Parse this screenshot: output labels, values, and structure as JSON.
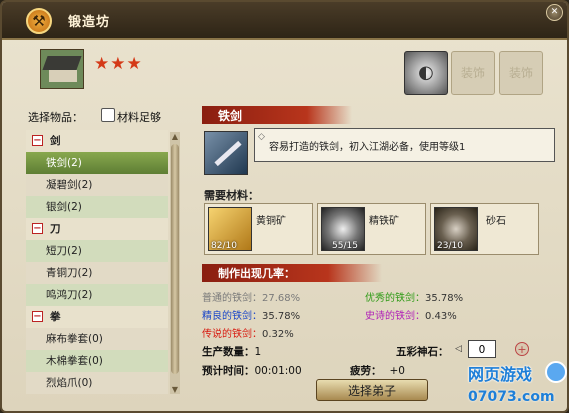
{
  "title": "锻造坊",
  "stars": "★★★",
  "equip_slots": [
    "装饰",
    "装饰"
  ],
  "select_label": "选择物品：",
  "material_enough_label": "材料足够",
  "item_list": [
    {
      "type": "category",
      "label": "剑"
    },
    {
      "type": "item",
      "label": "铁剑(2)",
      "selected": true
    },
    {
      "type": "item",
      "label": "凝碧剑(2)"
    },
    {
      "type": "item",
      "label": "银剑(2)"
    },
    {
      "type": "category",
      "label": "刀"
    },
    {
      "type": "item",
      "label": "短刀(2)"
    },
    {
      "type": "item",
      "label": "青铜刀(2)"
    },
    {
      "type": "item",
      "label": "鸣鸿刀(2)"
    },
    {
      "type": "category",
      "label": "拳"
    },
    {
      "type": "item",
      "label": "麻布拳套(0)"
    },
    {
      "type": "item",
      "label": "木棉拳套(0)"
    },
    {
      "type": "item",
      "label": "烈焰爪(0)"
    }
  ],
  "item": {
    "name": "铁剑",
    "description": "容易打造的铁剑，初入江湖必备，使用等级1"
  },
  "materials_heading": "需要材料：",
  "materials": [
    {
      "name": "黄铜矿",
      "count": "82/10"
    },
    {
      "name": "精铁矿",
      "count": "55/15"
    },
    {
      "name": "砂石",
      "count": "23/10"
    }
  ],
  "rates_heading": "制作出现几率：",
  "rates": [
    {
      "label": "普通的铁剑：",
      "value": "27.68%",
      "color": "#7a7a7a"
    },
    {
      "label": "优秀的铁剑：",
      "value": "35.78%",
      "color": "#2e9a16"
    },
    {
      "label": "精良的铁剑：",
      "value": "35.78%",
      "color": "#1a46c8"
    },
    {
      "label": "史诗的铁剑：",
      "value": "0.43%",
      "color": "#b020b8"
    },
    {
      "label": "传说的铁剑：",
      "value": "0.32%",
      "color": "#d81a10"
    }
  ],
  "production": {
    "quantity_label": "生产数量：",
    "quantity": "1",
    "time_label": "预计时间：",
    "time": "00:01:00",
    "fatigue_label": "疲劳：",
    "fatigue": "+0",
    "stone_label": "五彩神石：",
    "stone_value": "0"
  },
  "select_disciple_label": "选择弟子",
  "watermark": {
    "text": "网页游戏",
    "url": "07073.com"
  }
}
